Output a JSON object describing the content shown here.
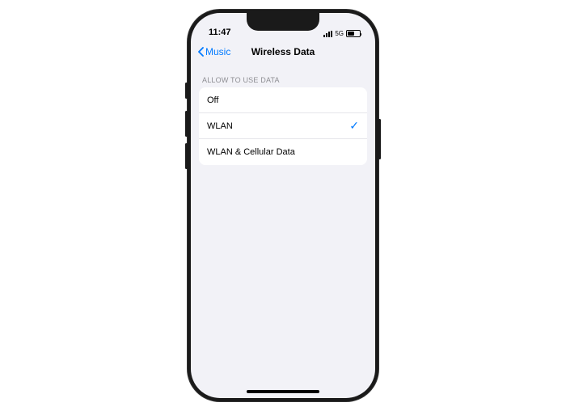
{
  "statusBar": {
    "time": "11:47",
    "network": "5G"
  },
  "nav": {
    "back": "Music",
    "title": "Wireless Data"
  },
  "section": {
    "header": "ALLOW TO USE DATA",
    "options": [
      {
        "label": "Off",
        "selected": false
      },
      {
        "label": "WLAN",
        "selected": true
      },
      {
        "label": "WLAN & Cellular Data",
        "selected": false
      }
    ]
  }
}
